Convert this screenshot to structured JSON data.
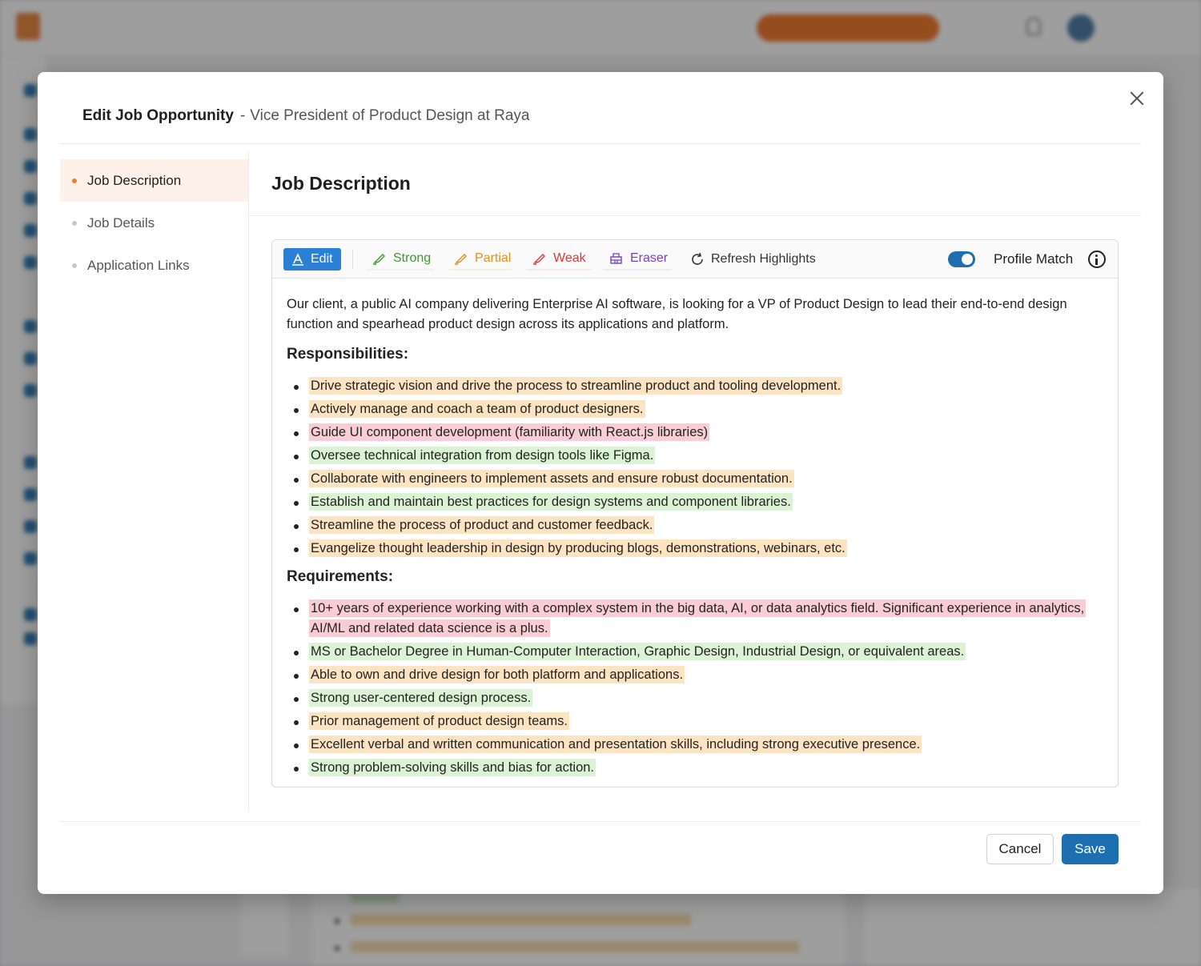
{
  "modal": {
    "title": "Edit Job Opportunity",
    "subtitle": "Vice President of Product Design at Raya",
    "dash": "-"
  },
  "nav": {
    "items": [
      {
        "label": "Job Description",
        "active": true
      },
      {
        "label": "Job Details",
        "active": false
      },
      {
        "label": "Application Links",
        "active": false
      }
    ]
  },
  "section_title": "Job Description",
  "toolbar": {
    "edit": "Edit",
    "strong": "Strong",
    "partial": "Partial",
    "weak": "Weak",
    "eraser": "Eraser",
    "refresh": "Refresh Highlights",
    "profile_match": "Profile Match",
    "profile_match_on": true
  },
  "doc": {
    "intro": "Our client, a public AI company delivering Enterprise AI software, is looking for a VP of Product Design to lead their end-to-end design function and spearhead product design across its applications and platform.",
    "responsibilities_heading": "Responsibilities:",
    "responsibilities": [
      {
        "text": "Drive strategic vision and drive the process to streamline product and tooling development.",
        "match": "partial"
      },
      {
        "text": "Actively manage and coach a team of product designers.",
        "match": "partial"
      },
      {
        "text": "Guide UI component development (familiarity with React.js libraries)",
        "match": "weak"
      },
      {
        "text": "Oversee technical integration from design tools like Figma.",
        "match": "strong"
      },
      {
        "text": "Collaborate with engineers to implement assets and ensure robust documentation.",
        "match": "partial"
      },
      {
        "text": "Establish and maintain best practices for design systems and component libraries.",
        "match": "strong"
      },
      {
        "text": "Streamline the process of product and customer feedback.",
        "match": "partial"
      },
      {
        "text": "Evangelize thought leadership in design by producing blogs, demonstrations, webinars, etc.",
        "match": "partial"
      }
    ],
    "requirements_heading": "Requirements:",
    "requirements": [
      {
        "text": "10+ years of experience working with a complex system in the big data, AI, or data analytics field. Significant experience in analytics, AI/ML and related data science is a plus.",
        "match": "weak"
      },
      {
        "text": "MS or Bachelor Degree in Human-Computer Interaction, Graphic Design, Industrial Design, or equivalent areas.",
        "match": "strong"
      },
      {
        "text": "Able to own and drive design for both platform and applications.",
        "match": "partial"
      },
      {
        "text": "Strong user-centered design process.",
        "match": "strong"
      },
      {
        "text": "Prior management of product design teams.",
        "match": "partial"
      },
      {
        "text": "Excellent verbal and written communication and presentation skills, including strong executive presence.",
        "match": "partial"
      },
      {
        "text": "Strong problem-solving skills and bias for action.",
        "match": "strong"
      }
    ]
  },
  "footer": {
    "cancel": "Cancel",
    "save": "Save"
  },
  "colors": {
    "strong_highlight": "#dcf2d4",
    "partial_highlight": "#fce4c2",
    "weak_highlight": "#f9cdd3",
    "primary": "#1d6fb0",
    "accent": "#ef7d31"
  },
  "icons": {
    "close": "close-icon",
    "edit": "text-edit-icon",
    "strong": "highlighter-icon",
    "partial": "highlighter-icon",
    "weak": "highlighter-icon",
    "eraser": "eraser-icon",
    "refresh": "refresh-icon",
    "info": "info-icon"
  }
}
